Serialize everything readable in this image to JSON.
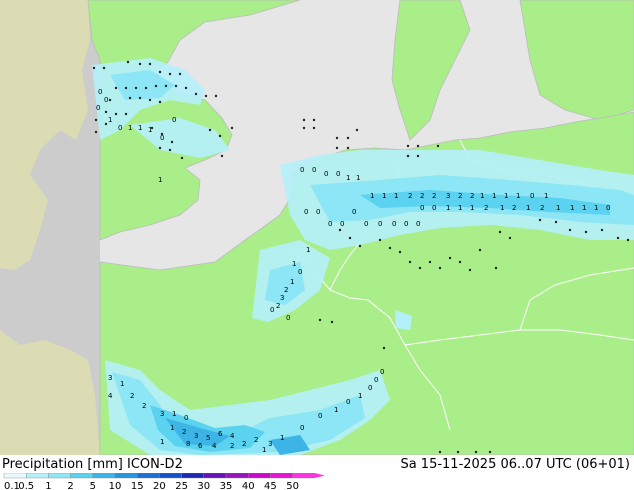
{
  "title": "Precipitation [mm]",
  "model": "ICON-D2",
  "datetime": "Sa 15-11-2025 06..07 UTC (06+01)",
  "colors": {
    "sea": "#e6e6e6",
    "land": "#aaee8a",
    "outside_domain": "#cccccc",
    "outside_domain_land": "#dcdcb4",
    "border": "#ffffff",
    "coast": "#bbbbbb"
  },
  "legend": {
    "stops": [
      {
        "label": "0.1",
        "color": "#e6fafe"
      },
      {
        "label": "0.5",
        "color": "#b4f0fa"
      },
      {
        "label": "1",
        "color": "#8ce6f5"
      },
      {
        "label": "2",
        "color": "#5ad2f0"
      },
      {
        "label": "5",
        "color": "#3cb4e6"
      },
      {
        "label": "10",
        "color": "#2896dc"
      },
      {
        "label": "15",
        "color": "#1e6ed2"
      },
      {
        "label": "20",
        "color": "#1450c8"
      },
      {
        "label": "25",
        "color": "#1e28b4"
      },
      {
        "label": "30",
        "color": "#6414b4"
      },
      {
        "label": "35",
        "color": "#9614be"
      },
      {
        "label": "40",
        "color": "#c80ac8"
      },
      {
        "label": "45",
        "color": "#e614d2"
      },
      {
        "label": "50",
        "color": "#ff32e6"
      }
    ]
  },
  "precip_values": [
    "0",
    "0",
    "0",
    "1",
    "0",
    "1",
    "1",
    "1",
    "0",
    "0",
    "1",
    "0",
    "0",
    "0",
    "0",
    "1",
    "1",
    "1",
    "1",
    "1",
    "2",
    "2",
    "2",
    "3",
    "2",
    "2",
    "1",
    "1",
    "1",
    "1",
    "0",
    "1",
    "0",
    "0",
    "1",
    "1",
    "1",
    "2",
    "1",
    "2",
    "1",
    "2",
    "1",
    "1",
    "1",
    "1",
    "0",
    "0",
    "0",
    "0",
    "0",
    "0",
    "0",
    "0",
    "0",
    "0",
    "0",
    "1",
    "0",
    "1",
    "1",
    "2",
    "3",
    "2",
    "0",
    "0",
    "3",
    "1",
    "4",
    "2",
    "2",
    "3",
    "1",
    "0",
    "1",
    "2",
    "3",
    "5",
    "6",
    "4",
    "2",
    "2",
    "3",
    "1",
    "1",
    "8",
    "6",
    "4",
    "2",
    "1",
    "0",
    "0",
    "1",
    "0",
    "1",
    "0",
    "0",
    "0",
    "0"
  ]
}
